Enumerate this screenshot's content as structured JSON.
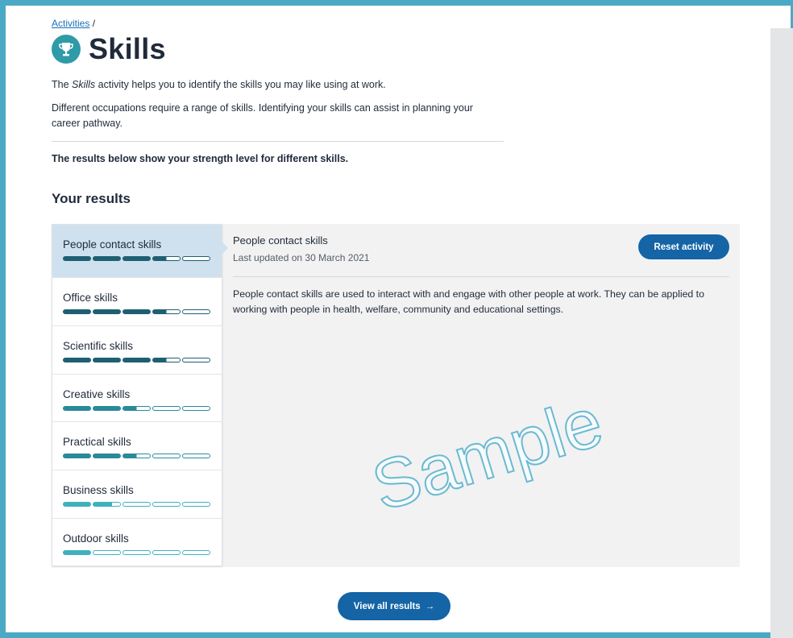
{
  "breadcrumb": {
    "link": "Activities",
    "separator": "/"
  },
  "page": {
    "title": "Skills",
    "icon": "trophy-icon",
    "intro_prefix": "The ",
    "intro_em": "Skills",
    "intro_suffix": " activity helps you to identify the skills you may like using at work.",
    "intro2": "Different occupations require a range of skills. Identifying your skills can assist in planning your career pathway.",
    "results_note": "The results below show your strength level for different skills.",
    "results_heading": "Your results"
  },
  "skills": [
    {
      "label": "People contact skills",
      "level": 3.5,
      "max": 5,
      "color": "#1f5f72"
    },
    {
      "label": "Office skills",
      "level": 3.5,
      "max": 5,
      "color": "#1f5f72"
    },
    {
      "label": "Scientific skills",
      "level": 3.5,
      "max": 5,
      "color": "#1f5f72"
    },
    {
      "label": "Creative skills",
      "level": 2.5,
      "max": 5,
      "color": "#2a8a98"
    },
    {
      "label": "Practical skills",
      "level": 2.5,
      "max": 5,
      "color": "#2a8a98"
    },
    {
      "label": "Business skills",
      "level": 1.7,
      "max": 5,
      "color": "#3fb0bd"
    },
    {
      "label": "Outdoor skills",
      "level": 1,
      "max": 5,
      "color": "#3fb0bd"
    }
  ],
  "selected_index": 0,
  "detail": {
    "title": "People contact skills",
    "updated": "Last updated on 30 March 2021",
    "reset_label": "Reset activity",
    "description": "People contact skills are used to interact with and engage with other people at work. They can be applied to working with people in health, welfare, community and educational settings."
  },
  "watermark": "Sample",
  "view_all_label": "View all results",
  "colors": {
    "accent": "#1464a6",
    "frame": "#4aa9c4",
    "selected_bg": "#cfe1ef"
  }
}
